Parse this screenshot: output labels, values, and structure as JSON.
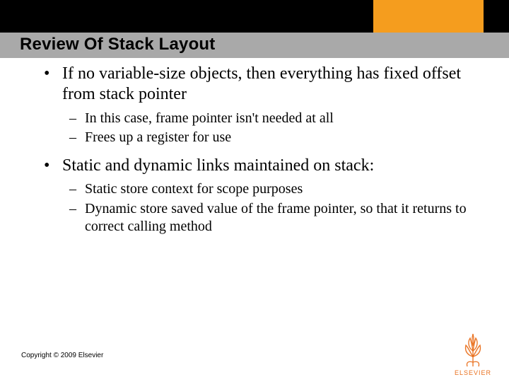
{
  "header": {
    "title": "Review Of Stack Layout"
  },
  "bullets": {
    "b1": "If no variable-size objects, then everything has fixed offset from stack pointer",
    "b1_sub1": "In this case, frame pointer isn't needed at all",
    "b1_sub2": "Frees up a register for use",
    "b2": "Static and dynamic links maintained on stack:",
    "b2_sub1": "Static store context for scope purposes",
    "b2_sub2": "Dynamic store saved value of the frame pointer, so that it returns to correct calling method"
  },
  "footer": {
    "copyright": "Copyright © 2009 Elsevier",
    "logo_text": "ELSEVIER"
  },
  "colors": {
    "accent_orange": "#f59d1e",
    "title_bar": "#a9a9a9",
    "logo_orange": "#e9701e"
  }
}
